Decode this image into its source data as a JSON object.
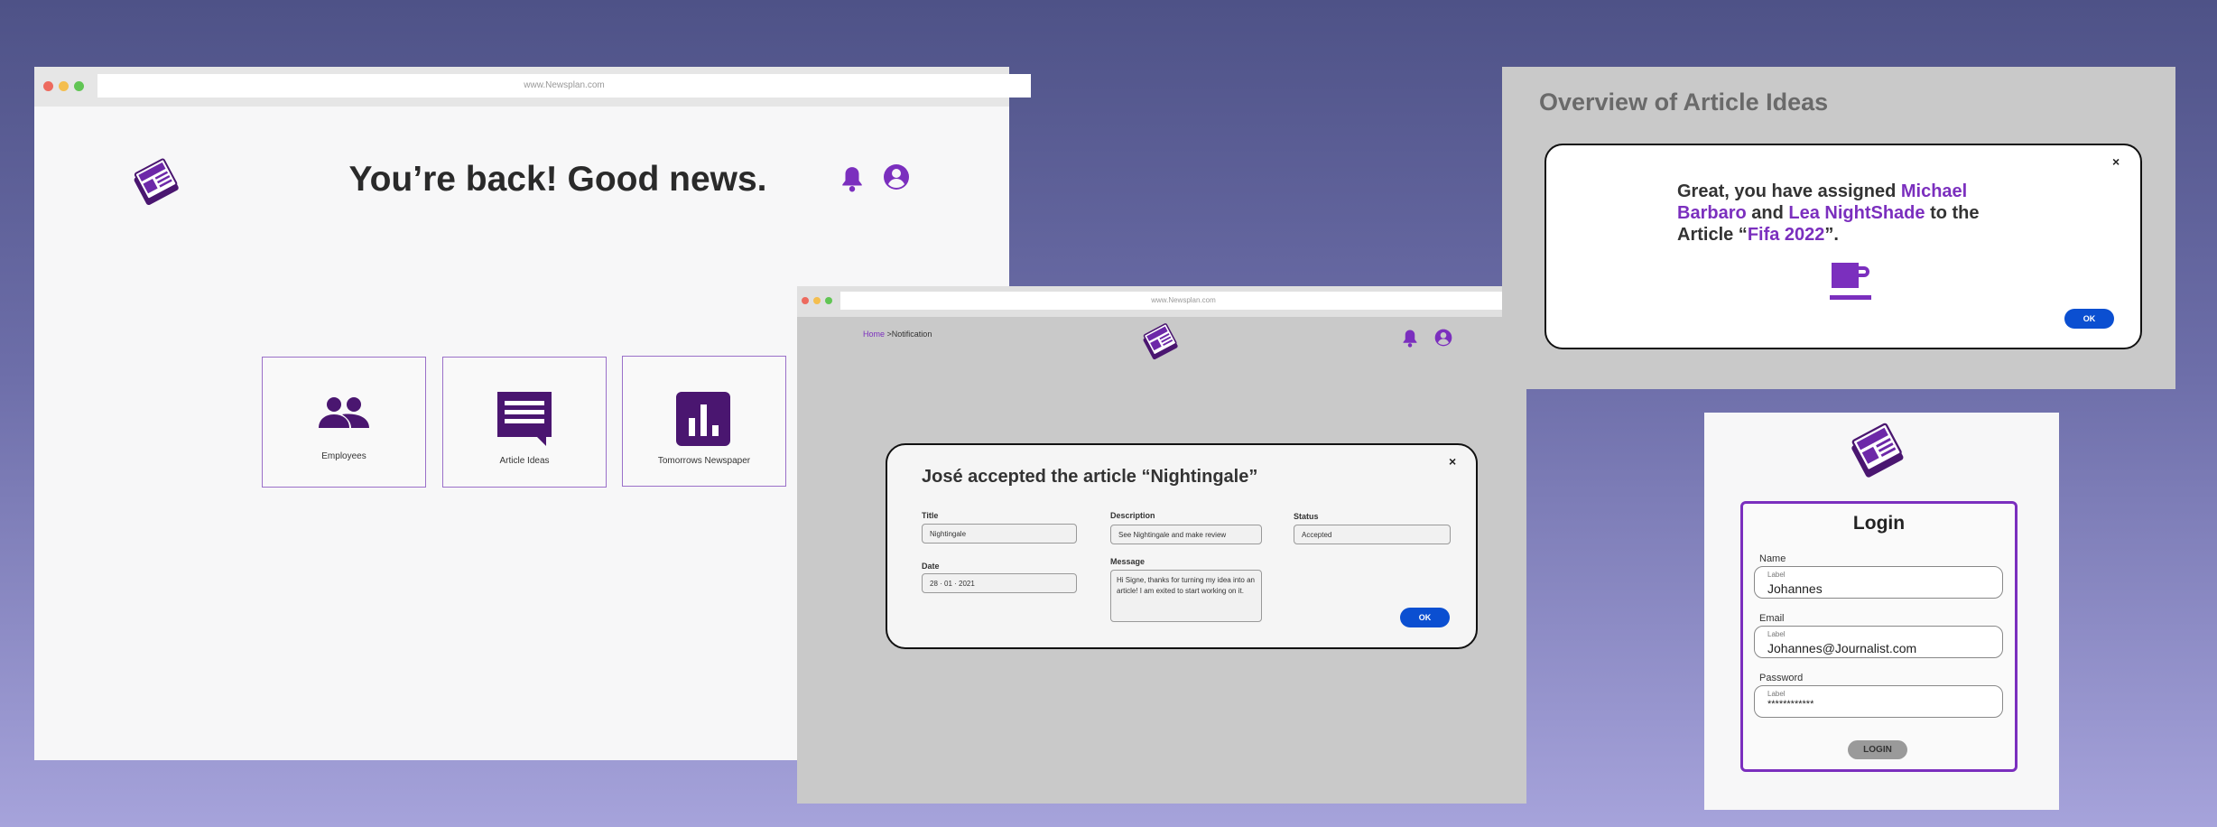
{
  "main_window": {
    "url": "www.Newsplan.com",
    "welcome": "You’re back! Good news.",
    "logo_icon": "newspaper-logo-icon",
    "cards": [
      {
        "label": "Employees",
        "icon": "people-icon"
      },
      {
        "label": "Article Ideas",
        "icon": "message-lines-icon"
      },
      {
        "label": "Tomorrows Newspaper",
        "icon": "bar-chart-icon"
      }
    ]
  },
  "notification_window": {
    "url": "www.Newsplan.com",
    "breadcrumb": {
      "home": "Home",
      "separator": ">",
      "current": "Notification"
    },
    "modal": {
      "title": "José accepted the article “Nightingale”",
      "title_label": "Title",
      "title_value": "Nightingale",
      "date_label": "Date",
      "date_value": "28 · 01 · 2021",
      "description_label": "Description",
      "description_value": "See Nightingale and make review",
      "message_label": "Message",
      "message_value": "Hi Signe, thanks for turning my idea into an article! I am exited to start working on it.",
      "status_label": "Status",
      "status_value": "Accepted",
      "ok": "OK",
      "close": "×"
    }
  },
  "overview_window": {
    "title": "Overview of Article Ideas",
    "text": {
      "p1": "Great, you have assigned ",
      "name1": "Michael Barbaro",
      "p2": " and ",
      "name2": "Lea NightShade",
      "p3": " to the Article “",
      "article": "Fifa 2022",
      "p4": "”."
    },
    "icon": "coffee-cup-icon",
    "ok": "OK",
    "close": "×"
  },
  "login_window": {
    "title": "Login",
    "fields": [
      {
        "label": "Name",
        "inner_label": "Label",
        "value": "Johannes"
      },
      {
        "label": "Email",
        "inner_label": "Label",
        "value": "Johannes@Journalist.com"
      },
      {
        "label": "Password",
        "inner_label": "Label",
        "value": "************"
      }
    ],
    "button": "LOGIN"
  },
  "colors": {
    "brand_purple": "#7b2fbe",
    "dark_purple": "#4a1670",
    "ok_blue": "#0b4fd1"
  }
}
